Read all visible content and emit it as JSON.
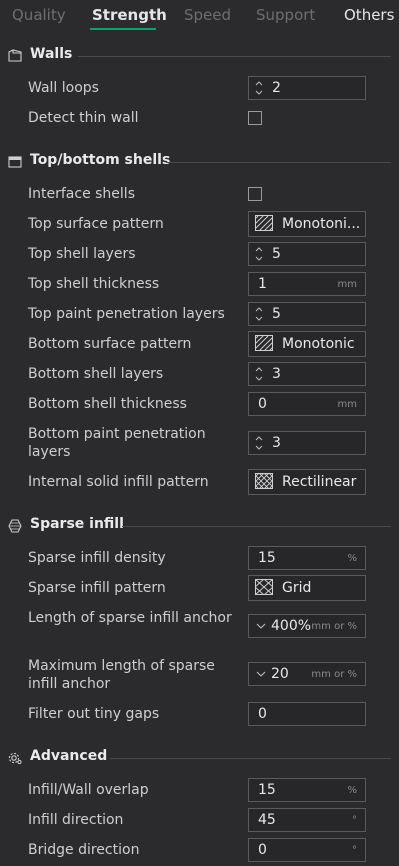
{
  "tabs": [
    {
      "label": "Quality"
    },
    {
      "label": "Strength"
    },
    {
      "label": "Speed"
    },
    {
      "label": "Support"
    },
    {
      "label": "Others"
    }
  ],
  "sections": {
    "walls": {
      "title": "Walls",
      "icon": "walls-icon"
    },
    "shells": {
      "title": "Top/bottom shells",
      "icon": "shells-icon"
    },
    "sparse": {
      "title": "Sparse infill",
      "icon": "sparse-infill-icon"
    },
    "advanced": {
      "title": "Advanced",
      "icon": "gear-icon"
    }
  },
  "walls": {
    "wall_loops": {
      "label": "Wall loops",
      "value": "2"
    },
    "detect_thin_wall": {
      "label": "Detect thin wall",
      "checked": false
    }
  },
  "shells": {
    "interface_shells": {
      "label": "Interface shells",
      "checked": false
    },
    "top_surface_pattern": {
      "label": "Top surface pattern",
      "value": "Monotoni..."
    },
    "top_shell_layers": {
      "label": "Top shell layers",
      "value": "5"
    },
    "top_shell_thickness": {
      "label": "Top shell thickness",
      "value": "1",
      "unit": "mm"
    },
    "top_paint_penetration_layers": {
      "label": "Top paint penetration layers",
      "value": "5"
    },
    "bottom_surface_pattern": {
      "label": "Bottom surface pattern",
      "value": "Monotonic"
    },
    "bottom_shell_layers": {
      "label": "Bottom shell layers",
      "value": "3"
    },
    "bottom_shell_thickness": {
      "label": "Bottom shell thickness",
      "value": "0",
      "unit": "mm"
    },
    "bottom_paint_penetration_layers": {
      "label": "Bottom paint penetration layers",
      "value": "3"
    },
    "internal_solid_infill_pattern": {
      "label": "Internal solid infill pattern",
      "value": "Rectilinear"
    }
  },
  "sparse": {
    "density": {
      "label": "Sparse infill density",
      "value": "15",
      "unit": "%"
    },
    "pattern": {
      "label": "Sparse infill pattern",
      "value": "Grid"
    },
    "anchor_length": {
      "label": "Length of sparse infill anchor",
      "value": "400%",
      "unit": "mm or %"
    },
    "anchor_max": {
      "label": "Maximum length of sparse infill anchor",
      "value": "20",
      "unit": "mm or %"
    },
    "filter_gaps": {
      "label": "Filter out tiny gaps",
      "value": "0"
    }
  },
  "advanced": {
    "overlap": {
      "label": "Infill/Wall overlap",
      "value": "15",
      "unit": "%"
    },
    "infill_direction": {
      "label": "Infill direction",
      "value": "45",
      "unit": "°"
    },
    "bridge_direction": {
      "label": "Bridge direction",
      "value": "0",
      "unit": "°"
    }
  },
  "colors": {
    "background": "#2b2b2e",
    "accent": "#00a86b",
    "field_border": "#5a5a5e"
  }
}
